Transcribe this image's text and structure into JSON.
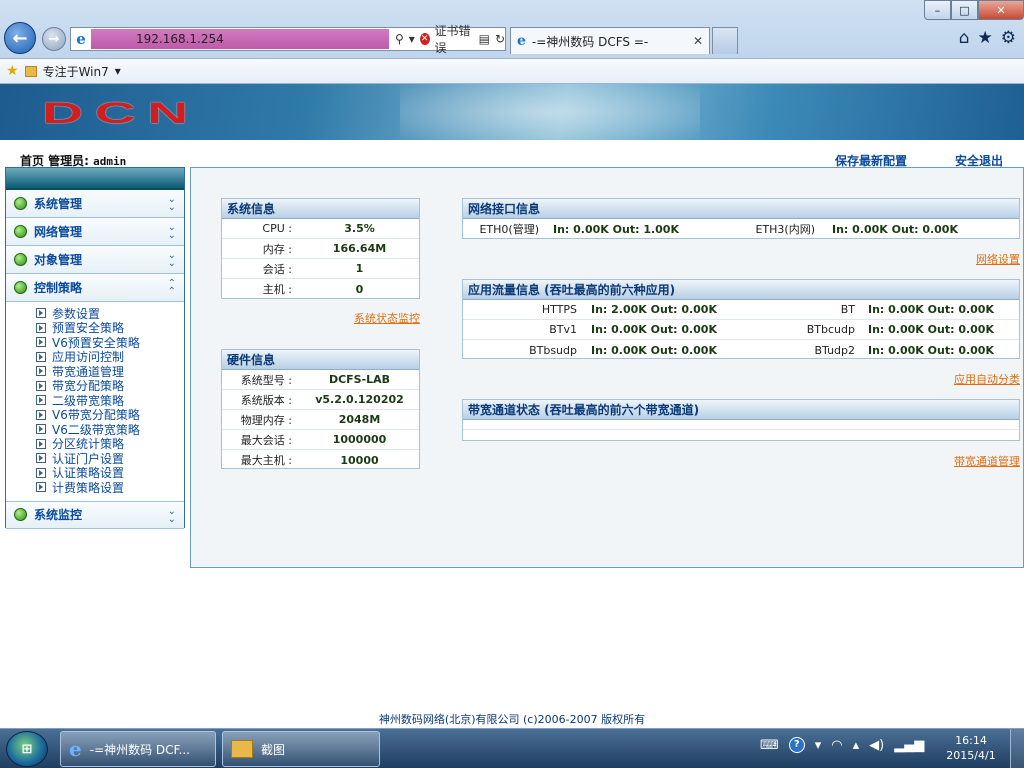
{
  "browser": {
    "address": "192.168.1.254",
    "cert_error": "证书错误",
    "tab_title": "-=神州数码 DCFS =-",
    "favorites_item": "专注于Win7",
    "window": {
      "minimize": "–",
      "maximize": "□",
      "close": "✕"
    }
  },
  "header": {
    "logo": "DCN",
    "breadcrumb": "首页 管理员:",
    "admin_name": "admin",
    "save_config": "保存最新配置",
    "logout": "安全退出"
  },
  "sidebar": {
    "items": [
      {
        "label": "系统管理",
        "expanded": false
      },
      {
        "label": "网络管理",
        "expanded": false
      },
      {
        "label": "对象管理",
        "expanded": false
      },
      {
        "label": "控制策略",
        "expanded": true
      },
      {
        "label": "系统监控",
        "expanded": false
      }
    ],
    "submenu": [
      "参数设置",
      "预置安全策略",
      "V6预置安全策略",
      "应用访问控制",
      "带宽通道管理",
      "带宽分配策略",
      "二级带宽策略",
      "V6带宽分配策略",
      "V6二级带宽策略",
      "分区统计策略",
      "认证门户设置",
      "认证策略设置",
      "计费策略设置"
    ]
  },
  "sysinfo": {
    "title": "系统信息",
    "rows": [
      {
        "k": "CPU",
        "v": "3.5%"
      },
      {
        "k": "内存",
        "v": "166.64M"
      },
      {
        "k": "会话",
        "v": "1"
      },
      {
        "k": "主机",
        "v": "0"
      }
    ],
    "link": "系统状态监控"
  },
  "hwinfo": {
    "title": "硬件信息",
    "rows": [
      {
        "k": "系统型号",
        "v": "DCFS-LAB"
      },
      {
        "k": "系统版本",
        "v": "v5.2.0.120202"
      },
      {
        "k": "物理内存",
        "v": "2048M"
      },
      {
        "k": "最大会话",
        "v": "1000000"
      },
      {
        "k": "最大主机",
        "v": "10000"
      }
    ]
  },
  "netif": {
    "title": "网络接口信息",
    "rows": [
      {
        "n1": "ETH0(管理)",
        "s1": "In: 0.00K Out: 1.00K",
        "n2": "ETH3(内网)",
        "s2": "In: 0.00K Out: 0.00K"
      }
    ],
    "link": "网络设置"
  },
  "appflow": {
    "title": "应用流量信息 (吞吐最高的前六种应用)",
    "rows": [
      {
        "n1": "HTTPS",
        "s1": "In: 2.00K Out: 0.00K",
        "n2": "BT",
        "s2": "In: 0.00K Out: 0.00K"
      },
      {
        "n1": "BTv1",
        "s1": "In: 0.00K Out: 0.00K",
        "n2": "BTbcudp",
        "s2": "In: 0.00K Out: 0.00K"
      },
      {
        "n1": "BTbsudp",
        "s1": "In: 0.00K Out: 0.00K",
        "n2": "BTudp2",
        "s2": "In: 0.00K Out: 0.00K"
      }
    ],
    "link": "应用自动分类"
  },
  "bwstatus": {
    "title": "带宽通道状态 (吞吐最高的前六个带宽通道)",
    "link": "带宽通道管理"
  },
  "footer": {
    "text": "神州数码网络(北京)有限公司 (c)2006-2007 版权所有"
  },
  "taskbar": {
    "start": "⊞",
    "task1": "-=神州数码 DCF...",
    "task2": "截图",
    "time": "16:14",
    "date": "2015/4/1"
  }
}
